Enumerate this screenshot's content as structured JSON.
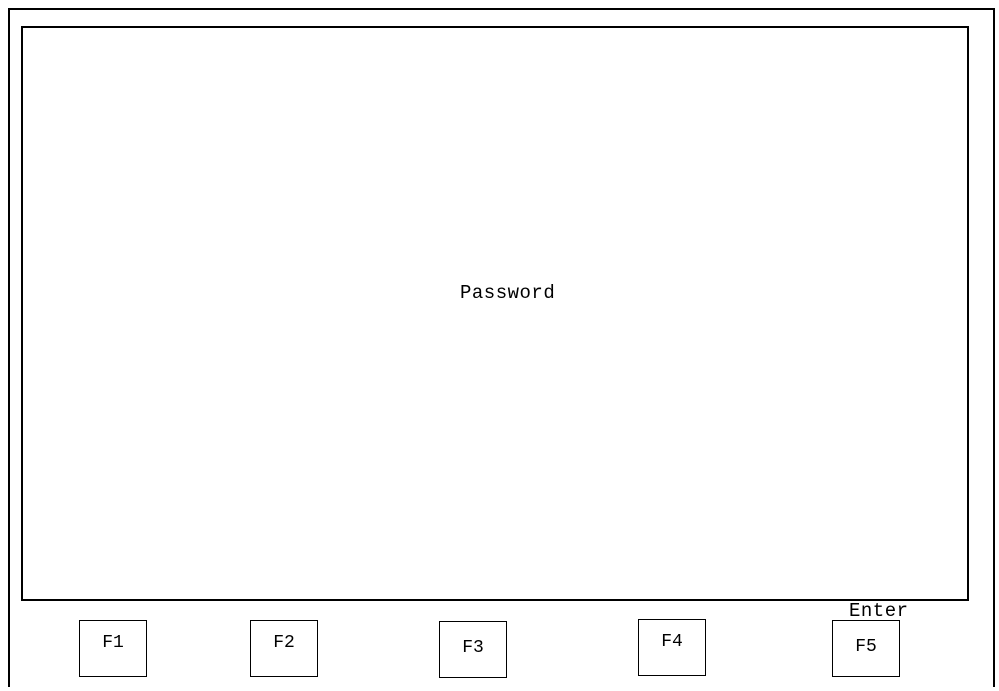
{
  "screen": {
    "prompt_label": "Password",
    "enter_label": "Enter"
  },
  "function_keys": [
    {
      "label": "F1"
    },
    {
      "label": "F2"
    },
    {
      "label": "F3"
    },
    {
      "label": "F4"
    },
    {
      "label": "F5"
    }
  ]
}
